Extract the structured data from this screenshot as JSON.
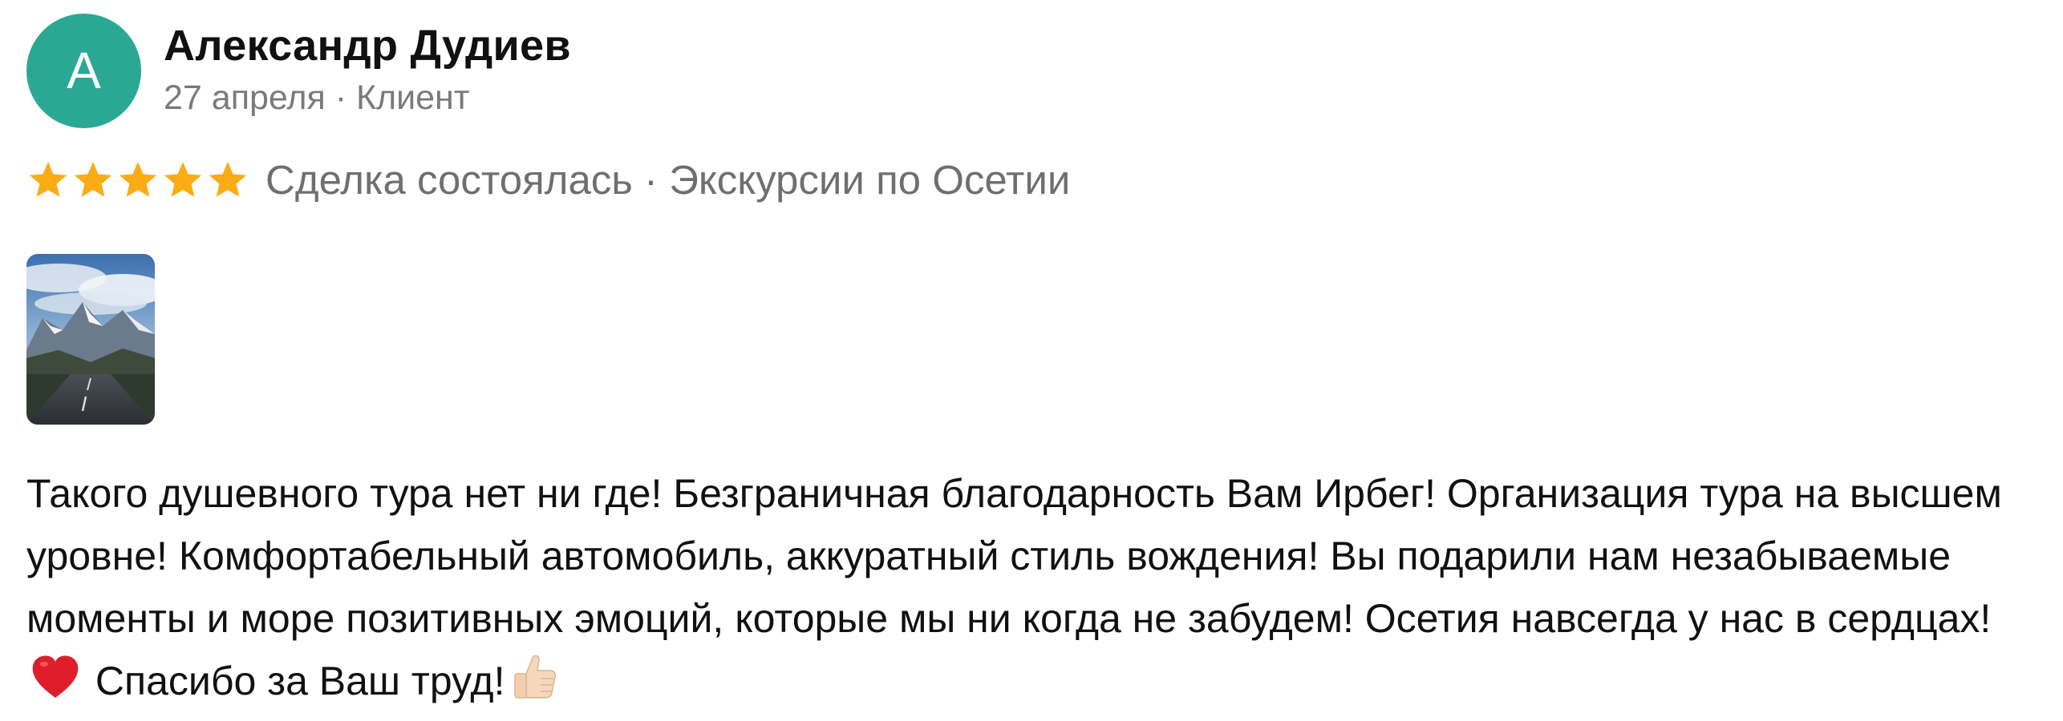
{
  "review": {
    "author": {
      "initial": "A",
      "name": "Александр Дудиев",
      "meta": "27 апреля · Клиент",
      "avatar_color": "#2ba894"
    },
    "rating": {
      "stars": 5,
      "max": 5,
      "star_color": "#fbab14"
    },
    "deal_info": "Сделка состоялась · Экскурсии по Осетии",
    "photo": {
      "icon": "mountain-road-photo"
    },
    "text_main": "Такого душевного тура нет ни где! Безграничная благодарность Вам Ирбег! Организация тура на высшем уровне! Комфортабельный автомобиль, аккуратный стиль вождения! Вы подарили нам незабываемые моменты и море позитивных эмоций, которые мы ни когда не забудем! Осетия навсегда у нас в сердцах!",
    "text_thanks": " Спасибо за Ваш труд!",
    "emojis": [
      "red-heart-icon",
      "thumbs-up-icon"
    ]
  }
}
